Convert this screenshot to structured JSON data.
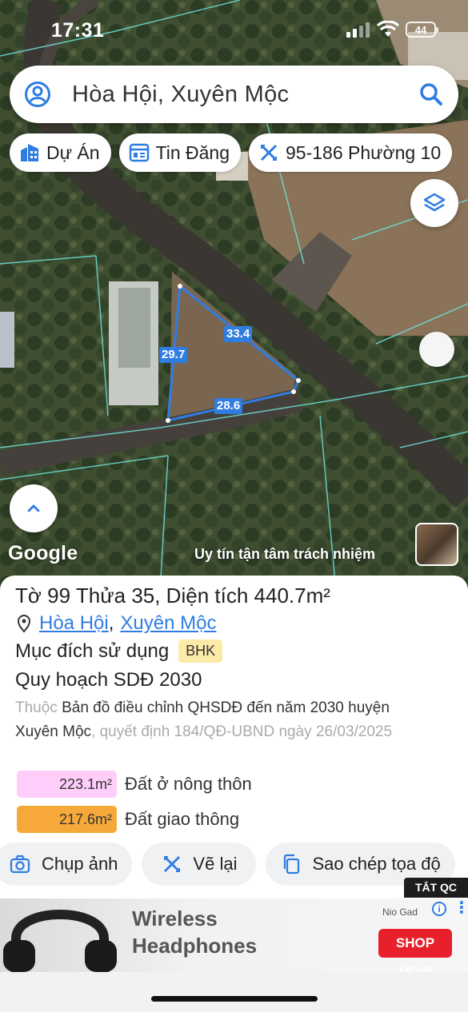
{
  "status": {
    "time": "17:31",
    "battery": "44"
  },
  "search": {
    "text": "Hòa Hội, Xuyên Mộc"
  },
  "chips": [
    {
      "label": "Dự Án",
      "icon": "building-icon"
    },
    {
      "label": "Tin Đăng",
      "icon": "listing-icon"
    },
    {
      "label": "95-186 Phường 10",
      "icon": "measure-icon"
    }
  ],
  "map": {
    "google_label": "Google",
    "motto": "Uy tín tận tâm trách nhiệm",
    "dimensions": [
      "33.4",
      "29.7",
      "28.6"
    ],
    "parcel_outline_color": "#2f7de1"
  },
  "panel": {
    "title_prefix": "Tờ",
    "sheet_no": "99",
    "parcel_prefix": "Thửa",
    "parcel_no": "35",
    "area_prefix": ", Diện tích",
    "area": "440.7m²",
    "location": {
      "commune": "Hòa Hội",
      "separator": ",",
      "district": "Xuyên Mộc"
    },
    "purpose_label": "Mục đích sử dụng",
    "purpose_code": "BHK",
    "plan_title": "Quy hoạch SDĐ 2030",
    "plan_desc": {
      "prefix": "Thuộc",
      "map_name": "Bản đồ điều chỉnh QHSDĐ đến năm 2030 huyện Xuyên Mộc",
      "decision": ", quyết định 184/QĐ-UBND ngày 26/03/2025"
    },
    "land_uses": [
      {
        "area": "223.1m²",
        "label": "Đất ở nông thôn",
        "color": "#ffcdfa"
      },
      {
        "area": "217.6m²",
        "label": "Đất giao thông",
        "color": "#f7a83a"
      }
    ],
    "actions": [
      {
        "label": "Chụp ảnh",
        "icon": "camera-icon"
      },
      {
        "label": "Vẽ lại",
        "icon": "redraw-icon"
      },
      {
        "label": "Sao chép tọa độ",
        "icon": "copy-icon"
      }
    ]
  },
  "ad": {
    "close_label": "TẮT QC",
    "title_line1": "Wireless",
    "title_line2": "Headphones",
    "brand": "Nio Gad",
    "cta": "SHOP NOW"
  }
}
